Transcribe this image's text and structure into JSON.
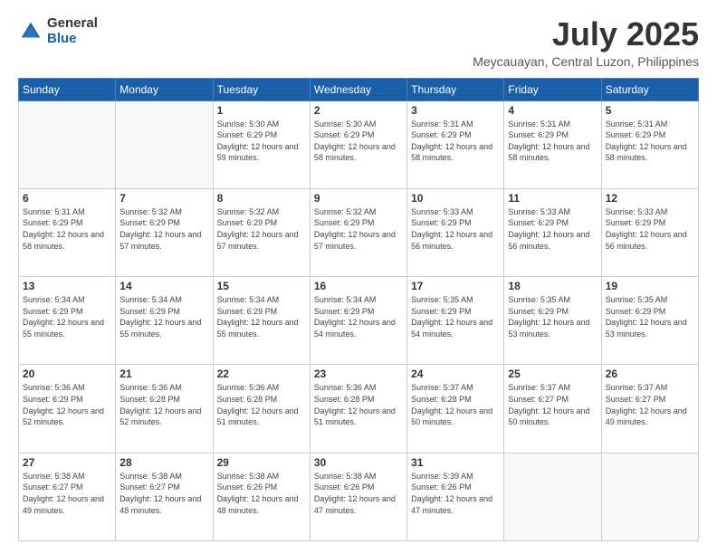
{
  "logo": {
    "general": "General",
    "blue": "Blue"
  },
  "header": {
    "month": "July 2025",
    "location": "Meycauayan, Central Luzon, Philippines"
  },
  "weekdays": [
    "Sunday",
    "Monday",
    "Tuesday",
    "Wednesday",
    "Thursday",
    "Friday",
    "Saturday"
  ],
  "weeks": [
    [
      {
        "day": "",
        "sunrise": "",
        "sunset": "",
        "daylight": ""
      },
      {
        "day": "",
        "sunrise": "",
        "sunset": "",
        "daylight": ""
      },
      {
        "day": "1",
        "sunrise": "Sunrise: 5:30 AM",
        "sunset": "Sunset: 6:29 PM",
        "daylight": "Daylight: 12 hours and 59 minutes."
      },
      {
        "day": "2",
        "sunrise": "Sunrise: 5:30 AM",
        "sunset": "Sunset: 6:29 PM",
        "daylight": "Daylight: 12 hours and 58 minutes."
      },
      {
        "day": "3",
        "sunrise": "Sunrise: 5:31 AM",
        "sunset": "Sunset: 6:29 PM",
        "daylight": "Daylight: 12 hours and 58 minutes."
      },
      {
        "day": "4",
        "sunrise": "Sunrise: 5:31 AM",
        "sunset": "Sunset: 6:29 PM",
        "daylight": "Daylight: 12 hours and 58 minutes."
      },
      {
        "day": "5",
        "sunrise": "Sunrise: 5:31 AM",
        "sunset": "Sunset: 6:29 PM",
        "daylight": "Daylight: 12 hours and 58 minutes."
      }
    ],
    [
      {
        "day": "6",
        "sunrise": "Sunrise: 5:31 AM",
        "sunset": "Sunset: 6:29 PM",
        "daylight": "Daylight: 12 hours and 58 minutes."
      },
      {
        "day": "7",
        "sunrise": "Sunrise: 5:32 AM",
        "sunset": "Sunset: 6:29 PM",
        "daylight": "Daylight: 12 hours and 57 minutes."
      },
      {
        "day": "8",
        "sunrise": "Sunrise: 5:32 AM",
        "sunset": "Sunset: 6:29 PM",
        "daylight": "Daylight: 12 hours and 57 minutes."
      },
      {
        "day": "9",
        "sunrise": "Sunrise: 5:32 AM",
        "sunset": "Sunset: 6:29 PM",
        "daylight": "Daylight: 12 hours and 57 minutes."
      },
      {
        "day": "10",
        "sunrise": "Sunrise: 5:33 AM",
        "sunset": "Sunset: 6:29 PM",
        "daylight": "Daylight: 12 hours and 56 minutes."
      },
      {
        "day": "11",
        "sunrise": "Sunrise: 5:33 AM",
        "sunset": "Sunset: 6:29 PM",
        "daylight": "Daylight: 12 hours and 56 minutes."
      },
      {
        "day": "12",
        "sunrise": "Sunrise: 5:33 AM",
        "sunset": "Sunset: 6:29 PM",
        "daylight": "Daylight: 12 hours and 56 minutes."
      }
    ],
    [
      {
        "day": "13",
        "sunrise": "Sunrise: 5:34 AM",
        "sunset": "Sunset: 6:29 PM",
        "daylight": "Daylight: 12 hours and 55 minutes."
      },
      {
        "day": "14",
        "sunrise": "Sunrise: 5:34 AM",
        "sunset": "Sunset: 6:29 PM",
        "daylight": "Daylight: 12 hours and 55 minutes."
      },
      {
        "day": "15",
        "sunrise": "Sunrise: 5:34 AM",
        "sunset": "Sunset: 6:29 PM",
        "daylight": "Daylight: 12 hours and 55 minutes."
      },
      {
        "day": "16",
        "sunrise": "Sunrise: 5:34 AM",
        "sunset": "Sunset: 6:29 PM",
        "daylight": "Daylight: 12 hours and 54 minutes."
      },
      {
        "day": "17",
        "sunrise": "Sunrise: 5:35 AM",
        "sunset": "Sunset: 6:29 PM",
        "daylight": "Daylight: 12 hours and 54 minutes."
      },
      {
        "day": "18",
        "sunrise": "Sunrise: 5:35 AM",
        "sunset": "Sunset: 6:29 PM",
        "daylight": "Daylight: 12 hours and 53 minutes."
      },
      {
        "day": "19",
        "sunrise": "Sunrise: 5:35 AM",
        "sunset": "Sunset: 6:29 PM",
        "daylight": "Daylight: 12 hours and 53 minutes."
      }
    ],
    [
      {
        "day": "20",
        "sunrise": "Sunrise: 5:36 AM",
        "sunset": "Sunset: 6:29 PM",
        "daylight": "Daylight: 12 hours and 52 minutes."
      },
      {
        "day": "21",
        "sunrise": "Sunrise: 5:36 AM",
        "sunset": "Sunset: 6:28 PM",
        "daylight": "Daylight: 12 hours and 52 minutes."
      },
      {
        "day": "22",
        "sunrise": "Sunrise: 5:36 AM",
        "sunset": "Sunset: 6:28 PM",
        "daylight": "Daylight: 12 hours and 51 minutes."
      },
      {
        "day": "23",
        "sunrise": "Sunrise: 5:36 AM",
        "sunset": "Sunset: 6:28 PM",
        "daylight": "Daylight: 12 hours and 51 minutes."
      },
      {
        "day": "24",
        "sunrise": "Sunrise: 5:37 AM",
        "sunset": "Sunset: 6:28 PM",
        "daylight": "Daylight: 12 hours and 50 minutes."
      },
      {
        "day": "25",
        "sunrise": "Sunrise: 5:37 AM",
        "sunset": "Sunset: 6:27 PM",
        "daylight": "Daylight: 12 hours and 50 minutes."
      },
      {
        "day": "26",
        "sunrise": "Sunrise: 5:37 AM",
        "sunset": "Sunset: 6:27 PM",
        "daylight": "Daylight: 12 hours and 49 minutes."
      }
    ],
    [
      {
        "day": "27",
        "sunrise": "Sunrise: 5:38 AM",
        "sunset": "Sunset: 6:27 PM",
        "daylight": "Daylight: 12 hours and 49 minutes."
      },
      {
        "day": "28",
        "sunrise": "Sunrise: 5:38 AM",
        "sunset": "Sunset: 6:27 PM",
        "daylight": "Daylight: 12 hours and 48 minutes."
      },
      {
        "day": "29",
        "sunrise": "Sunrise: 5:38 AM",
        "sunset": "Sunset: 6:26 PM",
        "daylight": "Daylight: 12 hours and 48 minutes."
      },
      {
        "day": "30",
        "sunrise": "Sunrise: 5:38 AM",
        "sunset": "Sunset: 6:26 PM",
        "daylight": "Daylight: 12 hours and 47 minutes."
      },
      {
        "day": "31",
        "sunrise": "Sunrise: 5:39 AM",
        "sunset": "Sunset: 6:26 PM",
        "daylight": "Daylight: 12 hours and 47 minutes."
      },
      {
        "day": "",
        "sunrise": "",
        "sunset": "",
        "daylight": ""
      },
      {
        "day": "",
        "sunrise": "",
        "sunset": "",
        "daylight": ""
      }
    ]
  ]
}
